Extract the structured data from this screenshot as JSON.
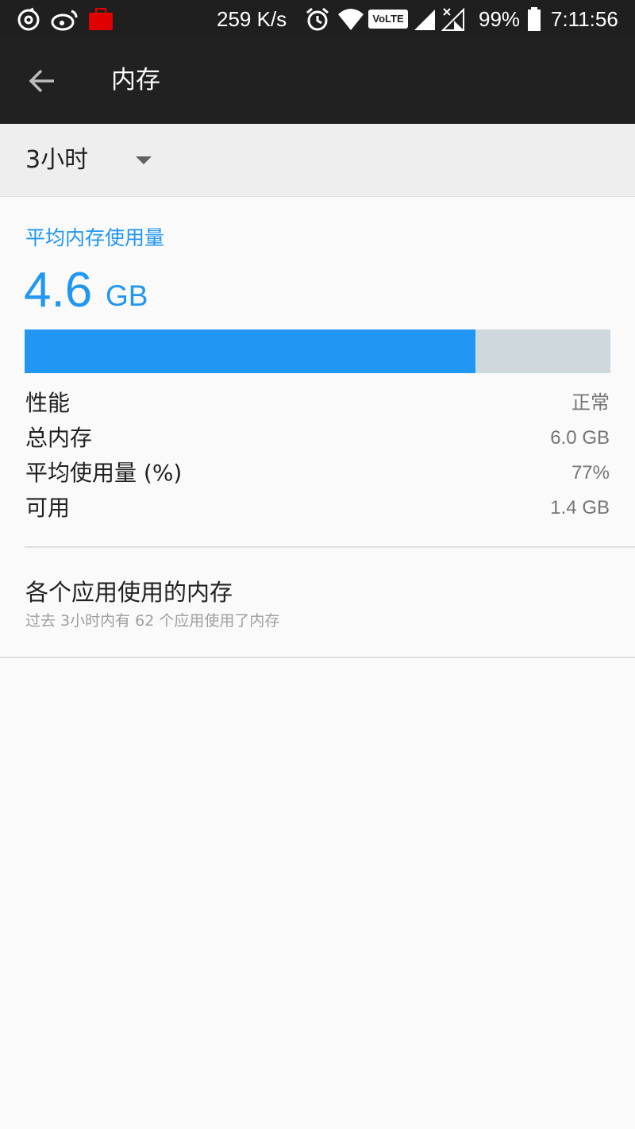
{
  "status_bar": {
    "net_speed": "259 K/s",
    "volte_label": "VoLTE",
    "battery": "99%",
    "time": "7:11:56",
    "icons": [
      "netease-music-icon",
      "weibo-icon",
      "red-bag-icon",
      "alarm-icon",
      "wifi-icon",
      "volte-icon",
      "signal-icon",
      "signal-no-service-icon",
      "battery-icon"
    ]
  },
  "toolbar": {
    "title": "内存"
  },
  "period": {
    "selected": "3小时"
  },
  "summary": {
    "title": "平均内存使用量",
    "value": "4.6",
    "unit": "GB",
    "usage_fraction": 0.77
  },
  "stats": [
    {
      "label": "性能",
      "value": "正常"
    },
    {
      "label": "总内存",
      "value": "6.0 GB"
    },
    {
      "label": "平均使用量 (%)",
      "value": "77%"
    },
    {
      "label": "可用",
      "value": "1.4 GB"
    }
  ],
  "apps": {
    "title": "各个应用使用的内存",
    "subtitle": "过去 3小时内有 62 个应用使用了内存"
  },
  "colors": {
    "accent": "#2196f3",
    "toolbar": "#212121",
    "bar_track": "#cfd8dc"
  }
}
